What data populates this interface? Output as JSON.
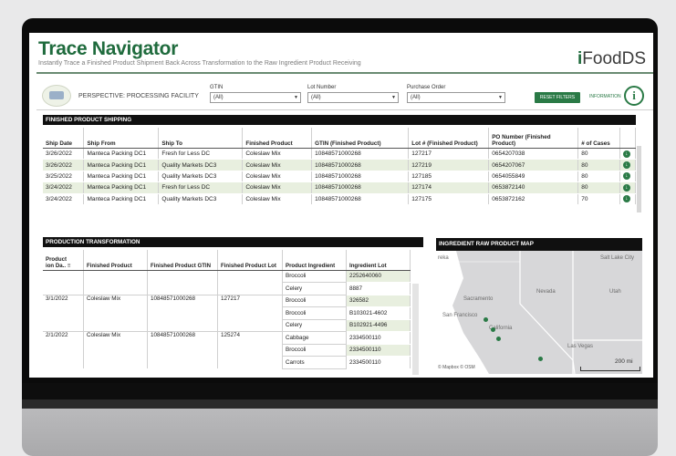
{
  "app": {
    "title": "Trace Navigator",
    "subtitle": "Instantly Trace a Finished Product Shipment Back Across Transformation to the Raw Ingredient Product Receiving",
    "brand_prefix": "i",
    "brand_rest": "FoodDS"
  },
  "toolbar": {
    "perspective": "PERSPECTIVE: PROCESSING FACILITY",
    "filters": [
      {
        "label": "GTIN",
        "value": "(All)"
      },
      {
        "label": "Lot Number",
        "value": "(All)"
      },
      {
        "label": "Purchase Order",
        "value": "(All)"
      }
    ],
    "reset_label": "RESET FILTERS",
    "info_label": "INFORMATION",
    "info_icon": "i"
  },
  "shipping": {
    "title": "FINISHED PRODUCT SHIPPING",
    "columns": [
      "Ship Date",
      "Ship From",
      "Ship To",
      "Finished Product",
      "GTIN (Finished Product)",
      "Lot # (Finished Product)",
      "PO Number (Finished Product)",
      "# of Cases"
    ],
    "rows": [
      [
        "3/26/2022",
        "Manteca Packing DC1",
        "Fresh for Less DC",
        "Coleslaw Mix",
        "10848571000268",
        "127217",
        "0654207038",
        "80"
      ],
      [
        "3/26/2022",
        "Manteca Packing DC1",
        "Quality Markets DC3",
        "Coleslaw Mix",
        "10848571000268",
        "127219",
        "0654207067",
        "80"
      ],
      [
        "3/25/2022",
        "Manteca Packing DC1",
        "Quality Markets DC3",
        "Coleslaw Mix",
        "10848571000268",
        "127185",
        "0654055849",
        "80"
      ],
      [
        "3/24/2022",
        "Manteca Packing DC1",
        "Fresh for Less DC",
        "Coleslaw Mix",
        "10848571000268",
        "127174",
        "0653872140",
        "80"
      ],
      [
        "3/24/2022",
        "Manteca Packing DC1",
        "Quality Markets DC3",
        "Coleslaw Mix",
        "10848571000268",
        "127175",
        "0653872162",
        "70"
      ]
    ]
  },
  "production": {
    "title": "PRODUCTION TRANSFORMATION",
    "columns": [
      "Product\nion Da..",
      "Finished Product",
      "Finished Product GTIN",
      "Finished Product Lot",
      "Product Ingredient",
      "Ingredient Lot"
    ],
    "sort_icon": "≡",
    "top_partial": {
      "ingredient": "Broccoli",
      "lot": "2252640060"
    },
    "groups": [
      {
        "date": "",
        "product": "",
        "gtin": "",
        "lot": "",
        "items": [
          {
            "ingredient": "Celery",
            "lot": "8887"
          }
        ]
      },
      {
        "date": "3/1/2022",
        "product": "Coleslaw Mix",
        "gtin": "10848571000268",
        "lot": "127217",
        "items": [
          {
            "ingredient": "Broccoli",
            "lot": "326582"
          },
          {
            "ingredient": "Broccoli",
            "lot": "B103021-4602"
          },
          {
            "ingredient": "Celery",
            "lot": "B102921-4496"
          }
        ]
      },
      {
        "date": "2/1/2022",
        "product": "Coleslaw Mix",
        "gtin": "10848571000268",
        "lot": "125274",
        "items": [
          {
            "ingredient": "Cabbage",
            "lot": "2334500110"
          },
          {
            "ingredient": "Broccoli",
            "lot": "2334500110"
          },
          {
            "ingredient": "Carrots",
            "lot": "2334500110"
          }
        ]
      }
    ]
  },
  "map": {
    "title": "INGREDIENT RAW PRODUCT MAP",
    "labels": {
      "eureka": "reka",
      "salt_lake": "Salt Lake City",
      "nevada": "Nevada",
      "utah": "Utah",
      "sacramento": "Sacramento",
      "san_francisco": "San Francisco",
      "california": "California",
      "las_vegas": "Las Vegas",
      "scale": "200 mi",
      "attribution": "© Mapbox  © OSM"
    }
  },
  "colors": {
    "brand_green": "#1f6b3d",
    "button_green": "#2a7a46",
    "row_alt": "#e8efdf",
    "header_black": "#101010"
  }
}
